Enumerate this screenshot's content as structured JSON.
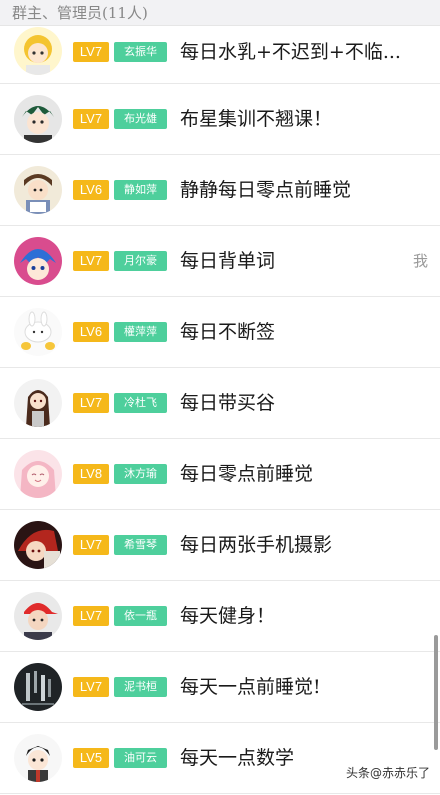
{
  "header": {
    "title": "群主、管理员(11人)"
  },
  "members": [
    {
      "level": "LV7",
      "title_tag": "玄振华",
      "name": "每日水乳+不迟到+不临...",
      "avatar_icon": "cartoon-girl-avatar-icon"
    },
    {
      "level": "LV7",
      "title_tag": "布光雄",
      "name": "布星集训不翘课！",
      "avatar_icon": "anime-boy-green-hair-avatar-icon"
    },
    {
      "level": "LV6",
      "title_tag": "静如萍",
      "name": "静静每日零点前睡觉",
      "avatar_icon": "anime-boy-book-avatar-icon"
    },
    {
      "level": "LV7",
      "title_tag": "月尔豪",
      "name": "每日背单词",
      "avatar_icon": "anime-boy-blue-hair-avatar-icon",
      "is_self": true,
      "self_label": "我"
    },
    {
      "level": "LV6",
      "title_tag": "權萍萍",
      "name": "每日不断签",
      "avatar_icon": "cartoon-bunny-avatar-icon"
    },
    {
      "level": "LV7",
      "title_tag": "冷杜飞",
      "name": "每日带买谷",
      "avatar_icon": "anime-girl-long-hair-avatar-icon"
    },
    {
      "level": "LV8",
      "title_tag": "沐方瑜",
      "name": "每日零点前睡觉",
      "avatar_icon": "anime-girl-pink-hair-avatar-icon"
    },
    {
      "level": "LV7",
      "title_tag": "希雪琴",
      "name": "每日两张手机摄影",
      "avatar_icon": "anime-boy-red-dark-avatar-icon"
    },
    {
      "level": "LV7",
      "title_tag": "依一瓶",
      "name": "每天健身！",
      "avatar_icon": "red-cap-boy-avatar-icon"
    },
    {
      "level": "LV7",
      "title_tag": "泥书桓",
      "name": "每天一点前睡觉!",
      "avatar_icon": "dark-text-avatar-icon"
    },
    {
      "level": "LV5",
      "title_tag": "油可云",
      "name": "每天一点数学",
      "avatar_icon": "chibi-boy-avatar-icon"
    }
  ],
  "colors": {
    "level_badge": "#f5b81a",
    "title_badge": "#4ecf9c",
    "header_bg": "#f2f2f4"
  },
  "watermark": "头条@赤赤乐了"
}
